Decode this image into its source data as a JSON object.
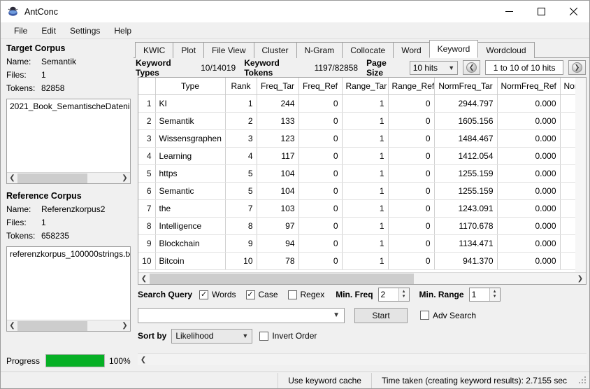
{
  "window": {
    "title": "AntConc",
    "icon": "antconc-ant-icon",
    "minimize": "—",
    "maximize": "☐",
    "close": "✕"
  },
  "menu": {
    "items": [
      {
        "label": "File"
      },
      {
        "label": "Edit"
      },
      {
        "label": "Settings"
      },
      {
        "label": "Help"
      }
    ]
  },
  "sidebar": {
    "target": {
      "title": "Target Corpus",
      "name_label": "Name:",
      "name_value": "Semantik",
      "files_label": "Files:",
      "files_value": "1",
      "tokens_label": "Tokens:",
      "tokens_value": "82858",
      "file_entry": "2021_Book_SemantischeDatenin"
    },
    "reference": {
      "title": "Reference Corpus",
      "name_label": "Name:",
      "name_value": "Referenzkorpus2",
      "files_label": "Files:",
      "files_value": "1",
      "tokens_label": "Tokens:",
      "tokens_value": "658235",
      "file_entry": "referenzkorpus_100000strings.tx"
    },
    "progress": {
      "label": "Progress",
      "percent_label": "100%",
      "percent_value": 100,
      "color": "#06b025"
    }
  },
  "tabs": [
    {
      "label": "KWIC",
      "active": false
    },
    {
      "label": "Plot",
      "active": false
    },
    {
      "label": "File View",
      "active": false
    },
    {
      "label": "Cluster",
      "active": false
    },
    {
      "label": "N-Gram",
      "active": false
    },
    {
      "label": "Collocate",
      "active": false
    },
    {
      "label": "Word",
      "active": false
    },
    {
      "label": "Keyword",
      "active": true
    },
    {
      "label": "Wordcloud",
      "active": false
    }
  ],
  "infobar": {
    "types_label": "Keyword Types",
    "types_value": "10/14019",
    "tokens_label": "Keyword Tokens",
    "tokens_value": "1197/82858",
    "pagesize_label": "Page Size",
    "pagesize_value": "10 hits",
    "prev_icon": "arrow-left-circle-icon",
    "hits_range": "1 to 10 of 10 hits",
    "next_icon": "arrow-right-circle-icon"
  },
  "table": {
    "columns": [
      "",
      "Type",
      "Rank",
      "Freq_Tar",
      "Freq_Ref",
      "Range_Tar",
      "Range_Ref",
      "NormFreq_Tar",
      "NormFreq_Ref",
      "NormRang"
    ],
    "rows": [
      {
        "idx": "1",
        "type": "KI",
        "rank": "1",
        "freq_tar": "244",
        "freq_ref": "0",
        "range_tar": "1",
        "range_ref": "0",
        "normfreq_tar": "2944.797",
        "normfreq_ref": "0.000",
        "normrange": ""
      },
      {
        "idx": "2",
        "type": "Semantik",
        "rank": "2",
        "freq_tar": "133",
        "freq_ref": "0",
        "range_tar": "1",
        "range_ref": "0",
        "normfreq_tar": "1605.156",
        "normfreq_ref": "0.000",
        "normrange": ""
      },
      {
        "idx": "3",
        "type": "Wissensgraphen",
        "rank": "3",
        "freq_tar": "123",
        "freq_ref": "0",
        "range_tar": "1",
        "range_ref": "0",
        "normfreq_tar": "1484.467",
        "normfreq_ref": "0.000",
        "normrange": ""
      },
      {
        "idx": "4",
        "type": "Learning",
        "rank": "4",
        "freq_tar": "117",
        "freq_ref": "0",
        "range_tar": "1",
        "range_ref": "0",
        "normfreq_tar": "1412.054",
        "normfreq_ref": "0.000",
        "normrange": ""
      },
      {
        "idx": "5",
        "type": "https",
        "rank": "5",
        "freq_tar": "104",
        "freq_ref": "0",
        "range_tar": "1",
        "range_ref": "0",
        "normfreq_tar": "1255.159",
        "normfreq_ref": "0.000",
        "normrange": ""
      },
      {
        "idx": "6",
        "type": "Semantic",
        "rank": "5",
        "freq_tar": "104",
        "freq_ref": "0",
        "range_tar": "1",
        "range_ref": "0",
        "normfreq_tar": "1255.159",
        "normfreq_ref": "0.000",
        "normrange": ""
      },
      {
        "idx": "7",
        "type": "the",
        "rank": "7",
        "freq_tar": "103",
        "freq_ref": "0",
        "range_tar": "1",
        "range_ref": "0",
        "normfreq_tar": "1243.091",
        "normfreq_ref": "0.000",
        "normrange": ""
      },
      {
        "idx": "8",
        "type": "Intelligence",
        "rank": "8",
        "freq_tar": "97",
        "freq_ref": "0",
        "range_tar": "1",
        "range_ref": "0",
        "normfreq_tar": "1170.678",
        "normfreq_ref": "0.000",
        "normrange": ""
      },
      {
        "idx": "9",
        "type": "Blockchain",
        "rank": "9",
        "freq_tar": "94",
        "freq_ref": "0",
        "range_tar": "1",
        "range_ref": "0",
        "normfreq_tar": "1134.471",
        "normfreq_ref": "0.000",
        "normrange": ""
      },
      {
        "idx": "10",
        "type": "Bitcoin",
        "rank": "10",
        "freq_tar": "78",
        "freq_ref": "0",
        "range_tar": "1",
        "range_ref": "0",
        "normfreq_tar": "941.370",
        "normfreq_ref": "0.000",
        "normrange": ""
      }
    ]
  },
  "search": {
    "title": "Search Query",
    "words_label": "Words",
    "words_checked": true,
    "case_label": "Case",
    "case_checked": true,
    "regex_label": "Regex",
    "regex_checked": false,
    "minfreq_label": "Min. Freq",
    "minfreq_value": "2",
    "minrange_label": "Min. Range",
    "minrange_value": "1",
    "query_value": "",
    "query_placeholder": "",
    "start_label": "Start",
    "adv_label": "Adv Search",
    "adv_checked": false,
    "sortby_label": "Sort by",
    "sortby_value": "Likelihood",
    "invert_label": "Invert Order",
    "invert_checked": false
  },
  "statusbar": {
    "cache_label": "Use keyword cache",
    "time_label": "Time taken (creating keyword results):  2.7155 sec"
  }
}
